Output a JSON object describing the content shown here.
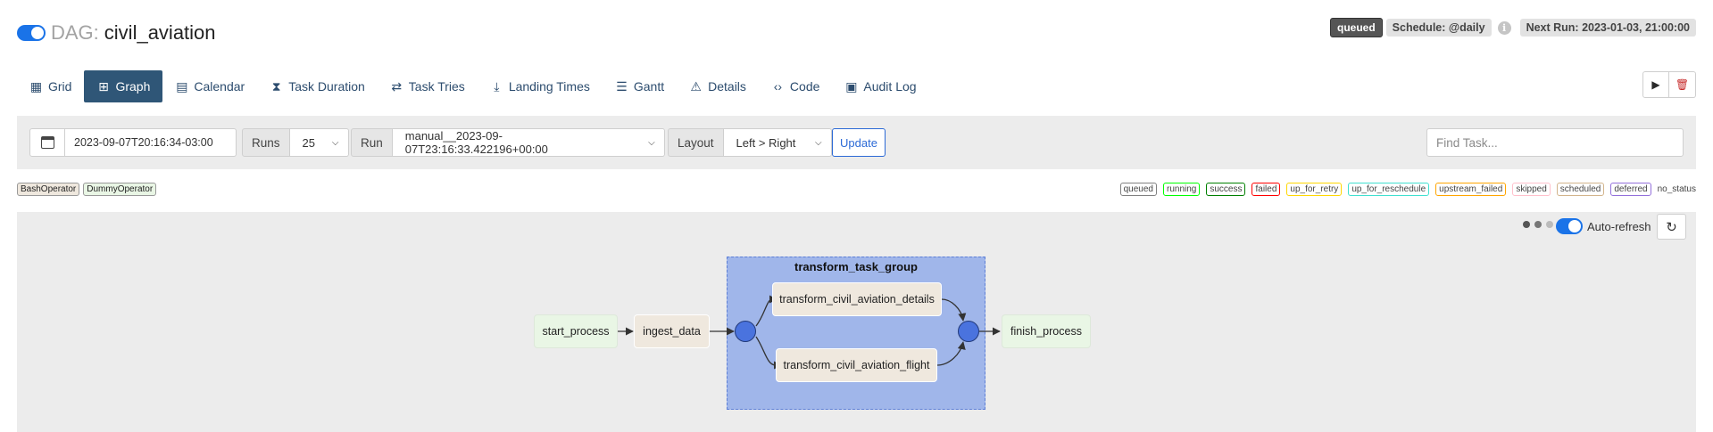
{
  "header": {
    "dag_prefix": "DAG:",
    "dag_id": "civil_aviation",
    "state": "queued",
    "schedule": "Schedule: @daily",
    "info_glyph": "i",
    "next_run": "Next Run: 2023-01-03, 21:00:00"
  },
  "nav": {
    "tabs": [
      {
        "label": "Grid",
        "icon": "grid-icon",
        "glyph": "▦"
      },
      {
        "label": "Graph",
        "icon": "graph-icon",
        "glyph": "⊞"
      },
      {
        "label": "Calendar",
        "icon": "calendar-icon",
        "glyph": "▤"
      },
      {
        "label": "Task Duration",
        "icon": "hourglass-icon",
        "glyph": "⧗"
      },
      {
        "label": "Task Tries",
        "icon": "retry-icon",
        "glyph": "⇄"
      },
      {
        "label": "Landing Times",
        "icon": "plane-landing-icon",
        "glyph": "⤓"
      },
      {
        "label": "Gantt",
        "icon": "gantt-icon",
        "glyph": "☰"
      },
      {
        "label": "Details",
        "icon": "warning-icon",
        "glyph": "⚠"
      },
      {
        "label": "Code",
        "icon": "code-icon",
        "glyph": "‹›"
      },
      {
        "label": "Audit Log",
        "icon": "file-icon",
        "glyph": "▣"
      }
    ],
    "active": "Graph",
    "play_glyph": "▶",
    "delete_glyph": "🗑"
  },
  "controls": {
    "date_value": "2023-09-07T20:16:34-03:00",
    "runs_label": "Runs",
    "runs_value": "25",
    "run_label": "Run",
    "run_value": "manual__2023-09-07T23:16:33.422196+00:00",
    "layout_label": "Layout",
    "layout_value": "Left > Right",
    "update_label": "Update",
    "find_placeholder": "Find Task..."
  },
  "operators": [
    {
      "label": "BashOperator",
      "color": "#efe8de"
    },
    {
      "label": "DummyOperator",
      "color": "#e9f6e5"
    }
  ],
  "states": [
    {
      "label": "queued",
      "color": "#808080"
    },
    {
      "label": "running",
      "color": "#00ff00"
    },
    {
      "label": "success",
      "color": "#008000"
    },
    {
      "label": "failed",
      "color": "#ff0000"
    },
    {
      "label": "up_for_retry",
      "color": "#ffd700"
    },
    {
      "label": "up_for_reschedule",
      "color": "#40e0d0"
    },
    {
      "label": "upstream_failed",
      "color": "#ffa500"
    },
    {
      "label": "skipped",
      "color": "#ffc0cb"
    },
    {
      "label": "scheduled",
      "color": "#d2b48c"
    },
    {
      "label": "deferred",
      "color": "#9370db"
    },
    {
      "label": "no_status",
      "color": ""
    }
  ],
  "graph": {
    "auto_refresh_label": "Auto-refresh",
    "refresh_glyph": "↻",
    "dot_colors": [
      "#555555",
      "#777777",
      "#bbbbbb"
    ],
    "group_label": "transform_task_group",
    "tasks": {
      "start_process": "start_process",
      "ingest_data": "ingest_data",
      "transform_details": "transform_civil_aviation_details",
      "transform_flight": "transform_civil_aviation_flight",
      "finish_process": "finish_process"
    }
  }
}
